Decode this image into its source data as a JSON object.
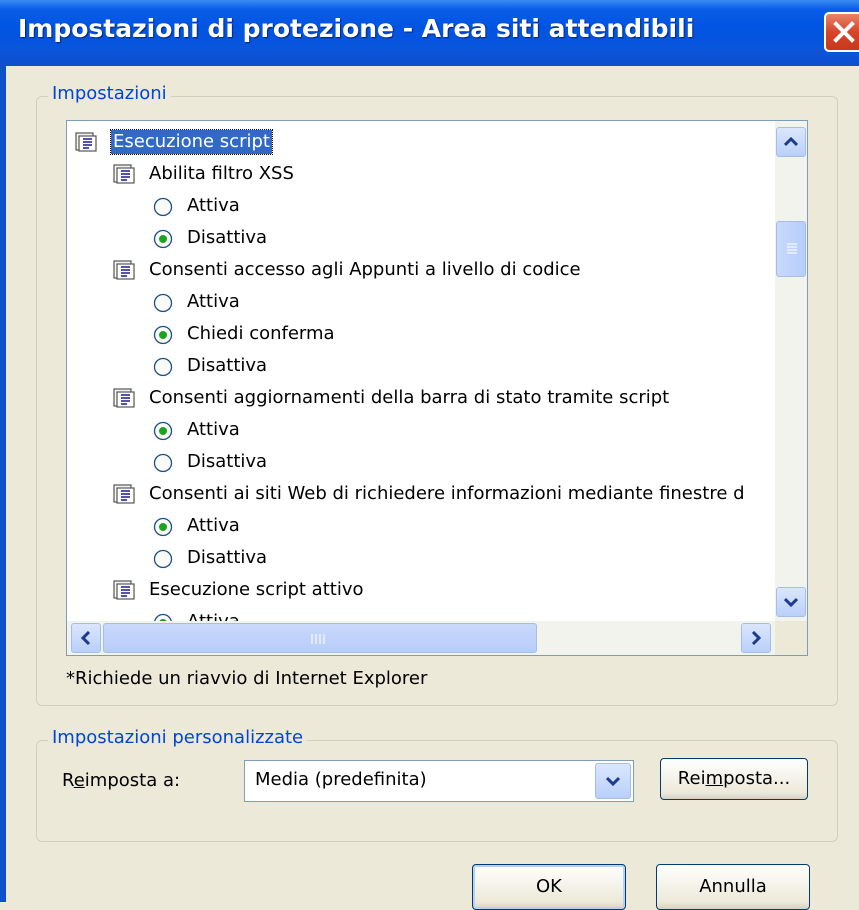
{
  "window": {
    "title": "Impostazioni di protezione - Area siti attendibili"
  },
  "settings_group": {
    "legend": "Impostazioni",
    "tree": [
      {
        "type": "category",
        "label": "Esecuzione script",
        "selected": true,
        "level": 0
      },
      {
        "type": "category",
        "label": "Abilita filtro XSS",
        "level": 1
      },
      {
        "type": "option",
        "label": "Attiva",
        "checked": false
      },
      {
        "type": "option",
        "label": "Disattiva",
        "checked": true
      },
      {
        "type": "category",
        "label": "Consenti accesso agli Appunti a livello di codice",
        "level": 1
      },
      {
        "type": "option",
        "label": "Attiva",
        "checked": false
      },
      {
        "type": "option",
        "label": "Chiedi conferma",
        "checked": true
      },
      {
        "type": "option",
        "label": "Disattiva",
        "checked": false
      },
      {
        "type": "category",
        "label": "Consenti aggiornamenti della barra di stato tramite script",
        "level": 1
      },
      {
        "type": "option",
        "label": "Attiva",
        "checked": true
      },
      {
        "type": "option",
        "label": "Disattiva",
        "checked": false
      },
      {
        "type": "category",
        "label": "Consenti ai siti Web di richiedere informazioni mediante finestre d",
        "level": 1
      },
      {
        "type": "option",
        "label": "Attiva",
        "checked": true
      },
      {
        "type": "option",
        "label": "Disattiva",
        "checked": false
      },
      {
        "type": "category",
        "label": "Esecuzione script attivo",
        "level": 1
      },
      {
        "type": "option",
        "label": "Attiva",
        "checked": true
      }
    ],
    "note": "*Richiede un riavvio di Internet Explorer"
  },
  "custom_group": {
    "legend": "Impostazioni personalizzate",
    "reset_label_pre": "R",
    "reset_label_u": "e",
    "reset_label_post": "imposta a:",
    "dropdown_value": "Media (predefinita)",
    "reset_btn_pre": "Rei",
    "reset_btn_u": "m",
    "reset_btn_post": "posta..."
  },
  "buttons": {
    "ok": "OK",
    "cancel": "Annulla"
  },
  "colors": {
    "accent": "#316ac5",
    "legend": "#0046d5",
    "radio_dot": "#21a121",
    "titlebar": "#0054e3"
  }
}
